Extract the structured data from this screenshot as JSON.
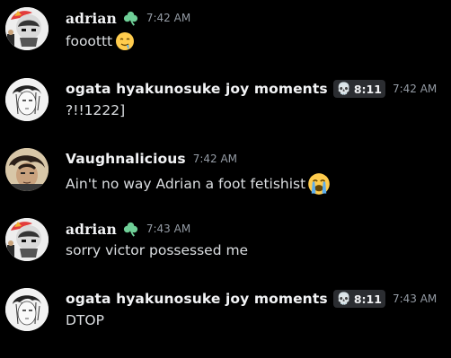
{
  "messages": [
    {
      "author": "adrian",
      "timestamp": "7:42 AM",
      "text": "fooottt",
      "emoji": "drooling-face",
      "avatar": "adrian-avatar",
      "badge": "clover-icon"
    },
    {
      "author": "ogata hyakunosuke joy moments",
      "tag": "8:11",
      "tag_icon": "skull-icon",
      "timestamp": "7:42 AM",
      "text": "?!!1222]",
      "avatar": "ogata-avatar"
    },
    {
      "author": "Vaughnalicious",
      "timestamp": "7:42 AM",
      "text": "Ain't no way Adrian a foot fetishist",
      "emoji": "loudly-crying-face",
      "avatar": "vaughn-avatar"
    },
    {
      "author": "adrian",
      "timestamp": "7:43 AM",
      "text": "sorry victor possessed me",
      "avatar": "adrian-avatar",
      "badge": "clover-icon"
    },
    {
      "author": "ogata hyakunosuke joy moments",
      "tag": "8:11",
      "tag_icon": "skull-icon",
      "timestamp": "7:43 AM",
      "text": "DTOP",
      "avatar": "ogata-avatar"
    }
  ],
  "colors": {
    "background": "#000000",
    "username": "#f2f3f5",
    "timestamp": "#949ba4",
    "text": "#dbdee1",
    "tag_bg": "#2b2d31"
  }
}
